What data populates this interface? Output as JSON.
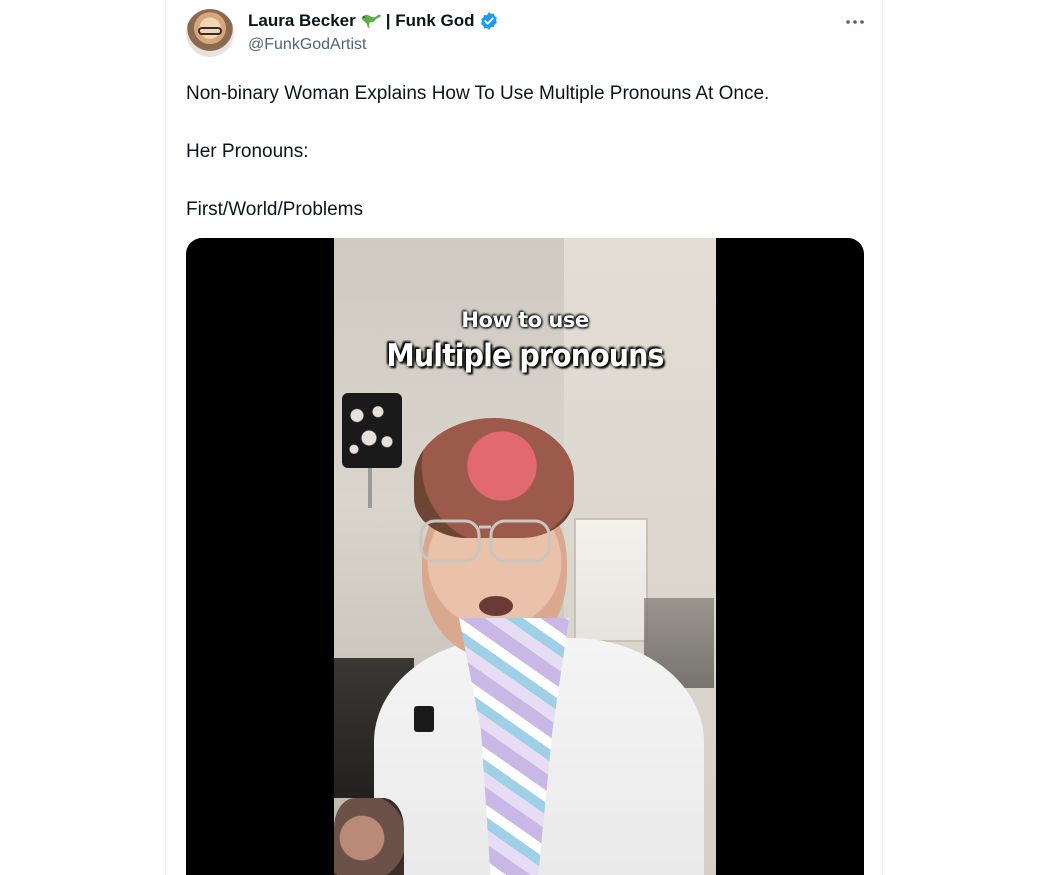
{
  "tweet": {
    "author": {
      "name_part1": "Laura Becker",
      "name_part2": "| Funk God",
      "handle": "@FunkGodArtist",
      "verified": true,
      "emoji_icon": "gecko-icon"
    },
    "text": {
      "line1": "Non-binary Woman Explains How To Use Multiple Pronouns At Once.",
      "line2": "Her Pronouns:",
      "line3": "First/World/Problems"
    },
    "media": {
      "type": "video",
      "caption_top": "How to use",
      "caption_bottom": "Multiple pronouns"
    }
  },
  "colors": {
    "verified": "#1d9bf0",
    "handle": "#536471",
    "text": "#0f1419"
  }
}
